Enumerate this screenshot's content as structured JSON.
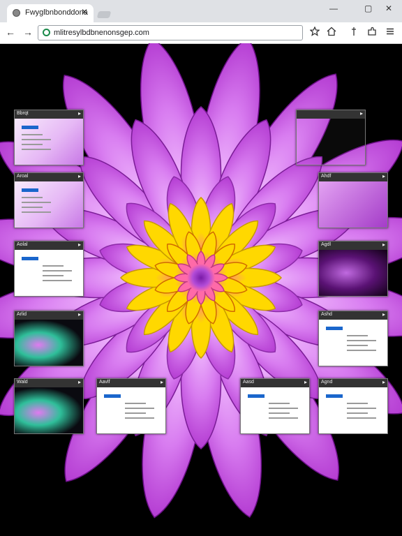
{
  "browser": {
    "tab_title": "Fwyglbnbonddona",
    "tab_close": "✕",
    "url": "mlitresylbdbnenonsgep.com",
    "minimize_icon": "—",
    "maximize_icon": "▢",
    "close_icon": "✕"
  },
  "thumbnails": [
    {
      "label": "Bbrqt"
    },
    {
      "label": ""
    },
    {
      "label": "Aroal"
    },
    {
      "label": "Ahdf"
    },
    {
      "label": "Aolal"
    },
    {
      "label": "Agdl"
    },
    {
      "label": "Arlid"
    },
    {
      "label": "Ashd"
    },
    {
      "label": "Wald"
    },
    {
      "label": "Aavlf"
    },
    {
      "label": "Aasd"
    },
    {
      "label": "Agnd"
    }
  ],
  "colors": {
    "petal_outer": "#b43cd2",
    "petal_mid": "#d87cf0",
    "petal_inner": "#f3c2ff",
    "center_yellow": "#ffd800",
    "center_pink": "#ff6aa8",
    "center_core": "#7a1aa8"
  }
}
